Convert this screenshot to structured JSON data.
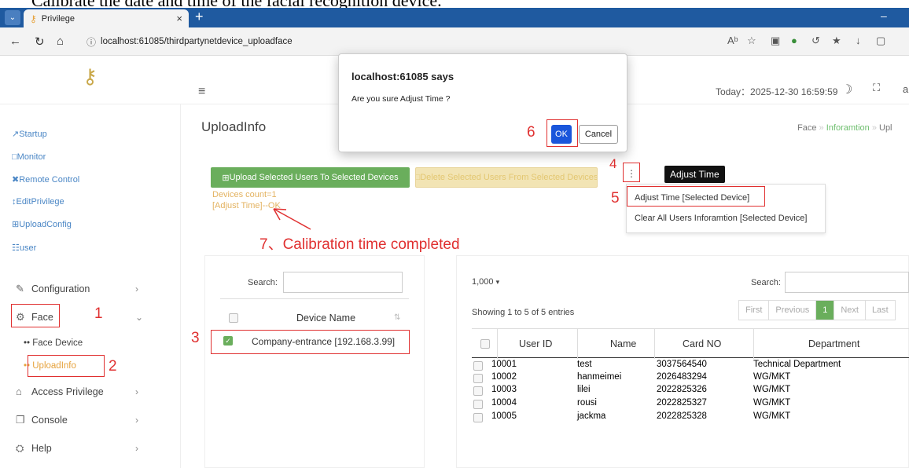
{
  "caption": "Calibrate the date and time of the facial recognition device.",
  "browser": {
    "tab_title": "Privilege",
    "url": "localhost:61085/thirdpartynetdevice_uploadface"
  },
  "header": {
    "today": "Today：2025-12-30 16:59:59",
    "user_initial": "a"
  },
  "dialog": {
    "title": "localhost:61085 says",
    "message": "Are you sure Adjust Time ?",
    "ok": "OK",
    "cancel": "Cancel"
  },
  "sidebar": {
    "top_items": [
      "Startup",
      "Monitor",
      "Remote Control",
      "EditPrivilege",
      "UploadConfig",
      "user"
    ],
    "menu": {
      "configuration": "Configuration",
      "face": "Face",
      "face_device": "Face Device",
      "uploadinfo": "UploadInfo",
      "access_privilege": "Access Privilege",
      "console": "Console",
      "help": "Help"
    }
  },
  "page": {
    "title": "UploadInfo",
    "breadcrumb": [
      "Face",
      "Inforamtion",
      "Upl"
    ]
  },
  "actions": {
    "upload": "Upload Selected Users To Selected Devices",
    "delete": "Delete Selected Users From Selected Devices",
    "tooltip": "Adjust Time",
    "devices_count": "Devices count=1",
    "adjust_result": "[Adjust Time]--OK",
    "menu_items": [
      "Adjust Time [Selected Device]",
      "Clear All Users Inforamtion [Selected Device]"
    ]
  },
  "annotations": {
    "n1": "1",
    "n2": "2",
    "n3": "3",
    "n4": "4",
    "n5": "5",
    "n6": "6",
    "n7": "7、Calibration time completed"
  },
  "devices": {
    "search_label": "Search:",
    "column": "Device Name",
    "rows": [
      "Company-entrance [192.168.3.99]"
    ]
  },
  "users": {
    "length": "1,000",
    "search_label": "Search:",
    "info": "Showing 1 to 5 of 5 entries",
    "pager": [
      "First",
      "Previous",
      "1",
      "Next",
      "Last"
    ],
    "columns": [
      "User ID",
      "Name",
      "Card NO",
      "Department"
    ],
    "rows": [
      [
        "10001",
        "test",
        "3037564540",
        "Technical Department"
      ],
      [
        "10002",
        "hanmeimei",
        "2026483294",
        "WG/MKT"
      ],
      [
        "10003",
        "lilei",
        "2022825326",
        "WG/MKT"
      ],
      [
        "10004",
        "rousi",
        "2022825327",
        "WG/MKT"
      ],
      [
        "10005",
        "jackma",
        "2022825328",
        "WG/MKT"
      ]
    ]
  },
  "colors": {
    "accent_green": "#6aae5c",
    "annotation_red": "#e03030",
    "dialog_blue": "#1a56db"
  }
}
